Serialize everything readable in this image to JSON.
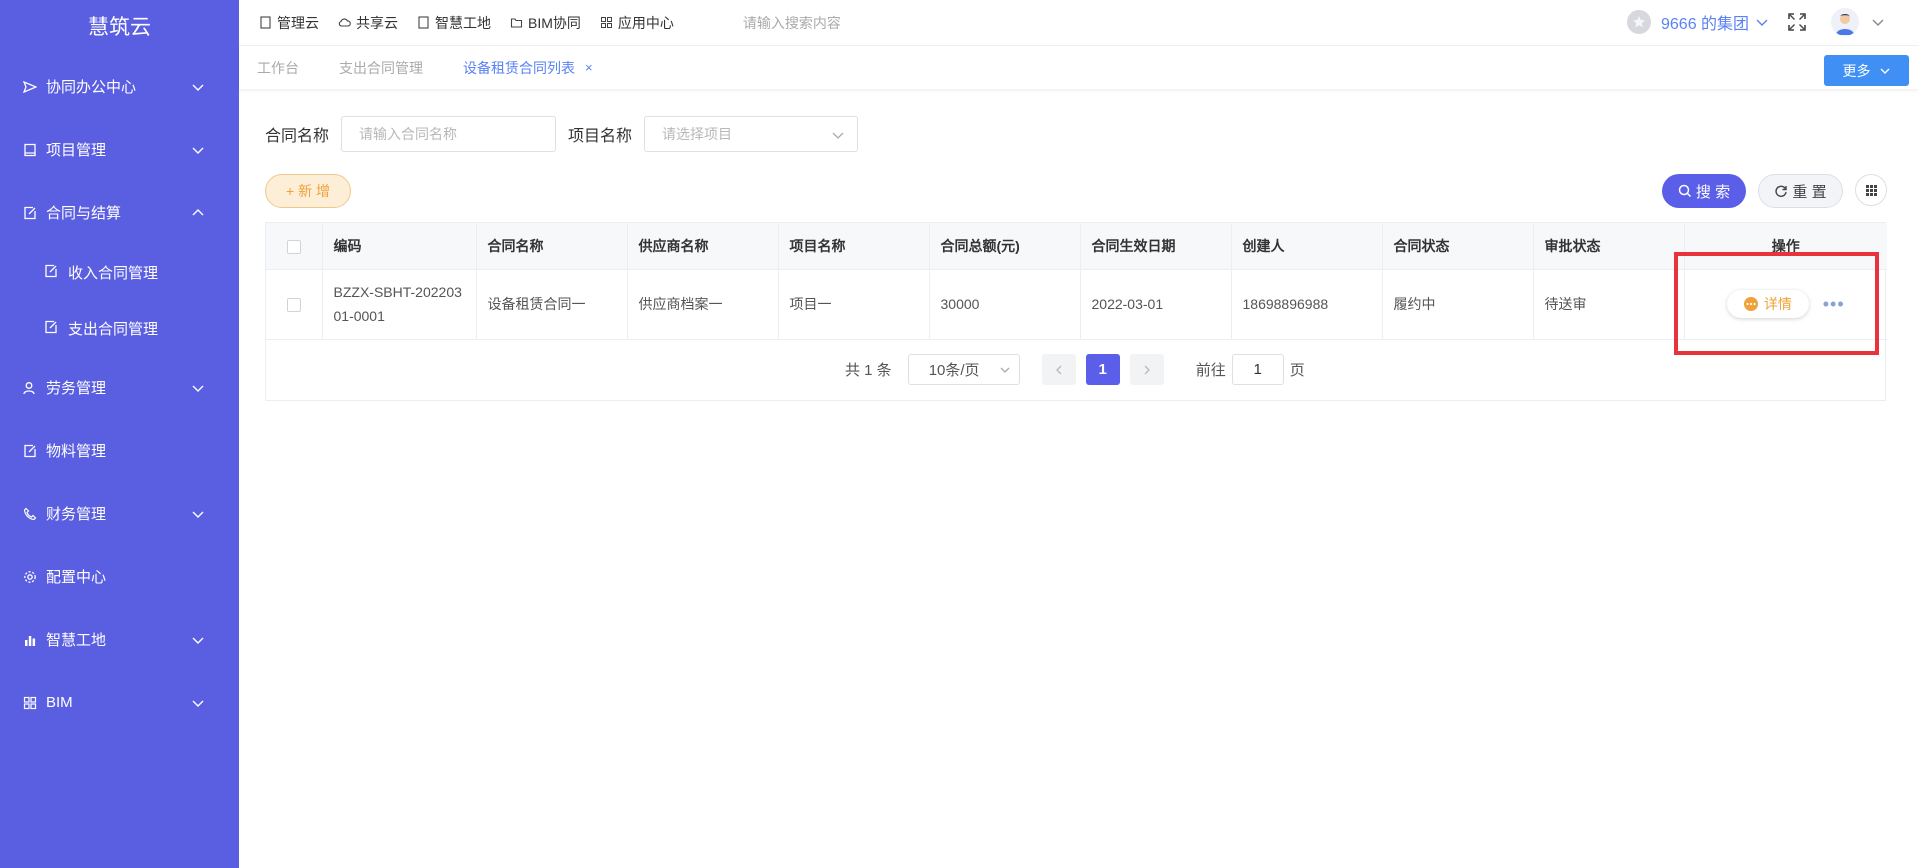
{
  "sidebar": {
    "brand": "慧筑云",
    "items": [
      {
        "label": "协同办公中心",
        "icon": "send-icon",
        "chevron": "down"
      },
      {
        "label": "项目管理",
        "icon": "book-icon",
        "chevron": "down"
      },
      {
        "label": "合同与结算",
        "icon": "edit-doc-icon",
        "chevron": "up"
      },
      {
        "label": "收入合同管理",
        "icon": "edit-doc-icon",
        "sub": true
      },
      {
        "label": "支出合同管理",
        "icon": "edit-doc-icon",
        "sub": true
      },
      {
        "label": "劳务管理",
        "icon": "user-group-icon",
        "chevron": "down"
      },
      {
        "label": "物料管理",
        "icon": "edit-doc-icon"
      },
      {
        "label": "财务管理",
        "icon": "phone-icon",
        "chevron": "down"
      },
      {
        "label": "配置中心",
        "icon": "gear-icon"
      },
      {
        "label": "智慧工地",
        "icon": "bar-chart-icon",
        "chevron": "down"
      },
      {
        "label": "BIM",
        "icon": "grid-icon",
        "chevron": "down"
      }
    ]
  },
  "topbar": {
    "links": [
      {
        "label": "管理云",
        "icon": "doc-icon"
      },
      {
        "label": "共享云",
        "icon": "cloud-icon"
      },
      {
        "label": "智慧工地",
        "icon": "doc-icon"
      },
      {
        "label": "BIM协同",
        "icon": "folder-icon"
      },
      {
        "label": "应用中心",
        "icon": "apps-icon"
      }
    ],
    "search_placeholder": "请输入搜索内容",
    "org_name": "9666 的集团"
  },
  "tabs": {
    "items": [
      {
        "label": "工作台",
        "active": false
      },
      {
        "label": "支出合同管理",
        "active": false
      },
      {
        "label": "设备租赁合同列表",
        "active": true,
        "closable": true
      }
    ],
    "close_glyph": "×",
    "more_label": "更多"
  },
  "filter": {
    "contract_name_label": "合同名称",
    "contract_name_placeholder": "请输入合同名称",
    "project_name_label": "项目名称",
    "project_name_placeholder": "请选择项目"
  },
  "actions": {
    "add_label": "+ 新 增",
    "search_label": "搜 索",
    "reset_label": "重 置"
  },
  "table": {
    "columns": [
      "编码",
      "合同名称",
      "供应商名称",
      "项目名称",
      "合同总额(元)",
      "合同生效日期",
      "创建人",
      "合同状态",
      "审批状态",
      "操作"
    ],
    "rows": [
      {
        "code": "BZZX-SBHT-20220301-0001",
        "contract_name": "设备租赁合同一",
        "supplier": "供应商档案一",
        "project": "项目一",
        "amount": "30000",
        "effective_date": "2022-03-01",
        "creator": "18698896988",
        "contract_status": "履约中",
        "approval_status": "待送审",
        "detail_label": "详情",
        "more_glyph": "•••"
      }
    ]
  },
  "pagination": {
    "total_text": "共 1 条",
    "page_size": "10条/页",
    "current_page": "1",
    "goto_prefix": "前往",
    "goto_value": "1",
    "goto_suffix": "页"
  },
  "colors": {
    "sidebar_bg": "#5a5ee0",
    "accent": "#5a5ee8",
    "link_blue": "#5a82f5",
    "warning_orange": "#f0a13a",
    "highlight_red": "#e8333c"
  }
}
